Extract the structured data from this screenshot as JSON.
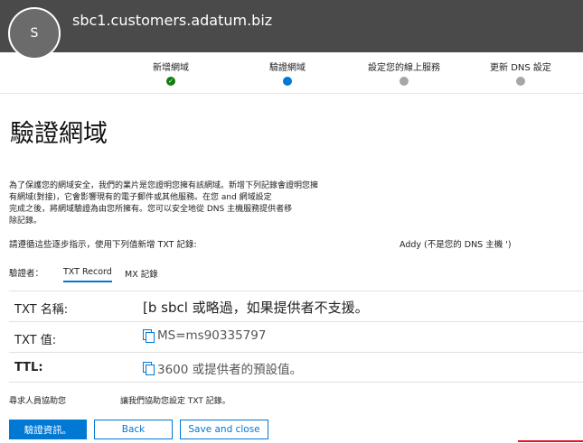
{
  "header": {
    "avatar_initial": "S",
    "domain": "sbc1.customers.adatum.biz"
  },
  "steps": [
    {
      "label": "新增網域",
      "state": "done"
    },
    {
      "label": "驗證網域",
      "state": "current"
    },
    {
      "label": "設定您的線上服務",
      "state": "pending"
    },
    {
      "label": "更新 DNS 設定",
      "state": "pending"
    }
  ],
  "page_title": "驗證網域",
  "intro_lines": [
    "為了保護您的網域安全，我們的業片是您證明您擁有該網域。新增下列記錄會證明您擁",
    "有網域(對接)，它會影響現有的電子郵件或其他服務。在您 and 網域設定",
    "完成之後，將網域驗證為由您所擁有。您可以安全地從 DNS 主機服務提供者移",
    "除記錄。"
  ],
  "instruction": "請遵循這些逐步指示，使用下列值新增 TXT 記錄:",
  "provider_hint": "Addy (不是您的 DNS 主機 ')",
  "verifier_label": "驗證者：",
  "tabs": [
    "TXT Record",
    "MX 記錄"
  ],
  "records": [
    {
      "label": "TXT 名稱:",
      "value": "[b sbcl 或略過，如果提供者不支援。"
    },
    {
      "label": "TXT 值:",
      "value": "MS=ms90335797"
    },
    {
      "label": "TTL:",
      "value": "3600 或提供者的預設值。"
    }
  ],
  "help": {
    "left": "尋求人員協助您",
    "right": "讓我們協助您設定 TXT 記錄。"
  },
  "buttons": {
    "primary": "驗證資訊。",
    "back": "Back",
    "save_close": "Save and close"
  }
}
